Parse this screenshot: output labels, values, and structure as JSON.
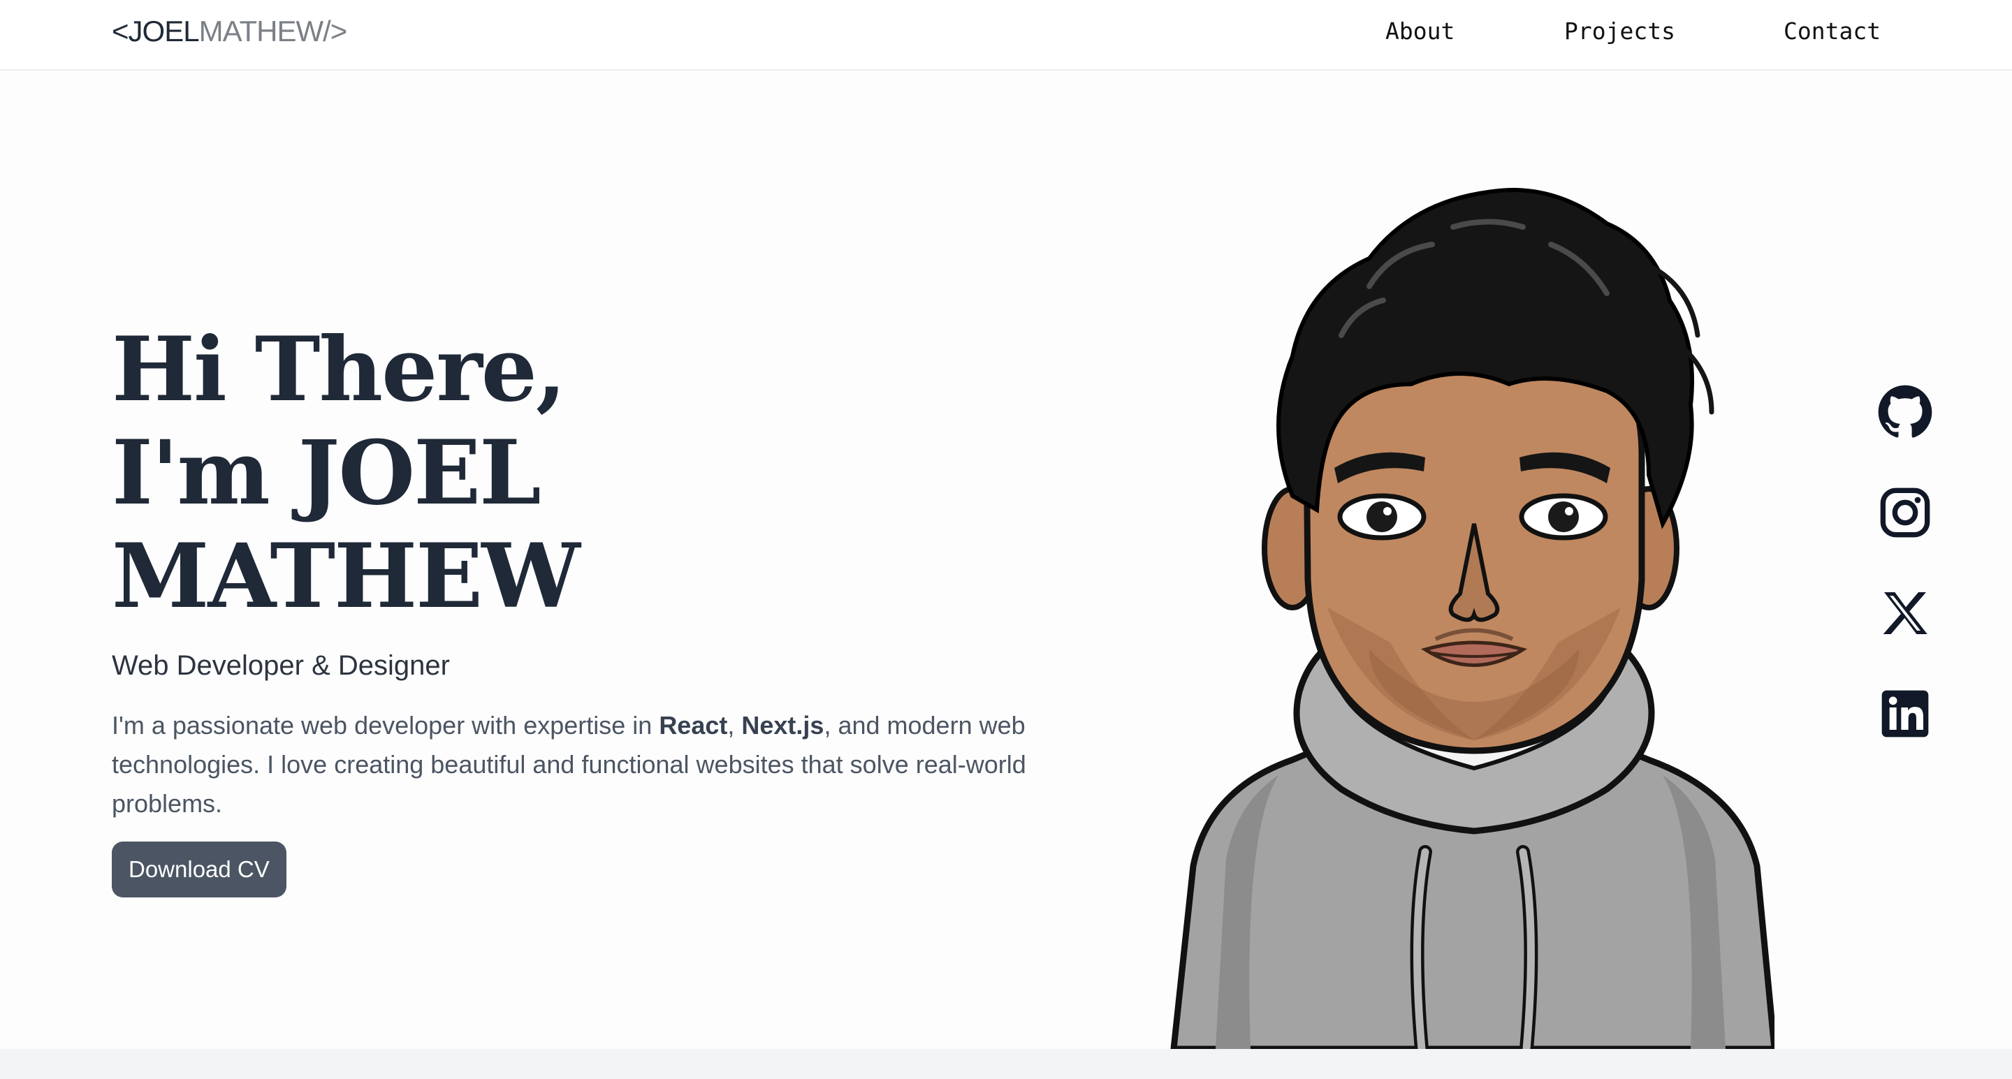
{
  "header": {
    "logo": {
      "open": "<",
      "first": "JOEL",
      "last": "MATHEW",
      "close": "/>"
    },
    "nav": [
      {
        "label": "About"
      },
      {
        "label": "Projects"
      },
      {
        "label": "Contact"
      }
    ]
  },
  "hero": {
    "greeting_line1": "Hi There,",
    "greeting_line2": "I'm JOEL MATHEW",
    "role": "Web Developer & Designer",
    "bio": {
      "before": "I'm a passionate web developer with expertise in ",
      "tech1": "React",
      "sep": ", ",
      "tech2": "Next.js",
      "after": ", and modern web technologies. I love creating beautiful and functional websites that solve real-world problems."
    },
    "cta_label": "Download CV"
  },
  "social": [
    {
      "icon": "github-icon"
    },
    {
      "icon": "instagram-icon"
    },
    {
      "icon": "x-icon"
    },
    {
      "icon": "linkedin-icon"
    }
  ],
  "colors": {
    "text_dark": "#1f2937",
    "text_muted": "#4b5563",
    "button_bg": "#4b5563",
    "page_bg": "#fdfdfd",
    "bottom_band": "#f3f4f6"
  }
}
